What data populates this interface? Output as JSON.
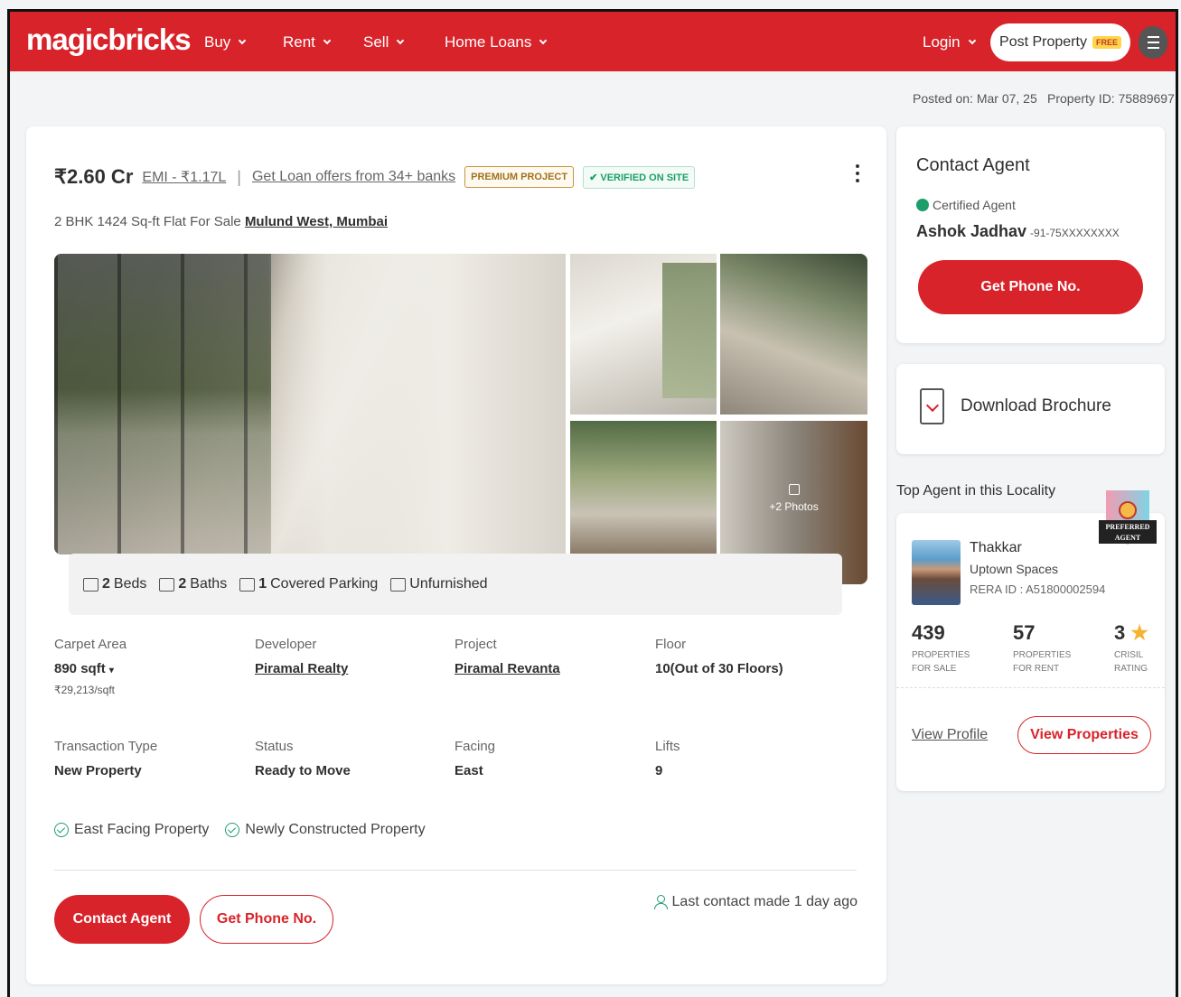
{
  "header": {
    "logo": "magicbricks",
    "nav": [
      "Buy",
      "Rent",
      "Sell",
      "Home Loans"
    ],
    "login": "Login",
    "post_property": "Post Property",
    "free_badge": "FREE",
    "brand_color": "#d8232a"
  },
  "meta": {
    "posted_on": "Posted on: Mar 07, 25",
    "property_id": "Property ID: 75889697"
  },
  "listing": {
    "price": "₹2.60 Cr",
    "emi": "EMI - ₹1.17L",
    "loan_offer": "Get Loan offers from 34+ banks",
    "badge_premium": "PREMIUM PROJECT",
    "badge_verified": "✔ VERIFIED ON SITE",
    "subtitle": "2 BHK 1424 Sq-ft Flat For Sale",
    "location": "Mulund West, Mumbai",
    "more_photos": "+2 Photos",
    "features": {
      "beds_count": "2",
      "beds_label": "Beds",
      "baths_count": "2",
      "baths_label": "Baths",
      "parking_count": "1",
      "parking_label": "Covered Parking",
      "furnishing": "Unfurnished"
    },
    "details": [
      {
        "label": "Carpet Area",
        "value": "890 sqft",
        "sub": "₹29,213/sqft"
      },
      {
        "label": "Developer",
        "value": "Piramal Realty"
      },
      {
        "label": "Project",
        "value": "Piramal Revanta"
      },
      {
        "label": "Floor",
        "value": "10(Out of 30 Floors)"
      },
      {
        "label": "Transaction Type",
        "value": "New Property"
      },
      {
        "label": "Status",
        "value": "Ready to Move"
      },
      {
        "label": "Facing",
        "value": "East"
      },
      {
        "label": "Lifts",
        "value": "9"
      }
    ],
    "tags": [
      "East Facing Property",
      "Newly Constructed Property"
    ],
    "contact_agent": "Contact Agent",
    "get_phone": "Get Phone No.",
    "last_contact": "Last contact made 1 day ago"
  },
  "contact_card": {
    "title": "Contact Agent",
    "certified": "Certified Agent",
    "name": "Ashok Jadhav",
    "phone": "-91-75XXXXXXXX",
    "button": "Get Phone No."
  },
  "brochure": {
    "label": "Download Brochure"
  },
  "top_agent": {
    "section_title": "Top Agent in this Locality",
    "preferred_line1": "PREFERRED",
    "preferred_line2": "AGENT",
    "name": "Thakkar",
    "company": "Uptown Spaces",
    "rera": "RERA ID : A51800002594",
    "stats": [
      {
        "num": "439",
        "cap1": "PROPERTIES",
        "cap2": "FOR SALE"
      },
      {
        "num": "57",
        "cap1": "PROPERTIES",
        "cap2": "FOR RENT"
      },
      {
        "num": "3",
        "cap1": "CRISIL",
        "cap2": "RATING"
      }
    ],
    "view_profile": "View Profile",
    "view_properties": "View Properties"
  }
}
